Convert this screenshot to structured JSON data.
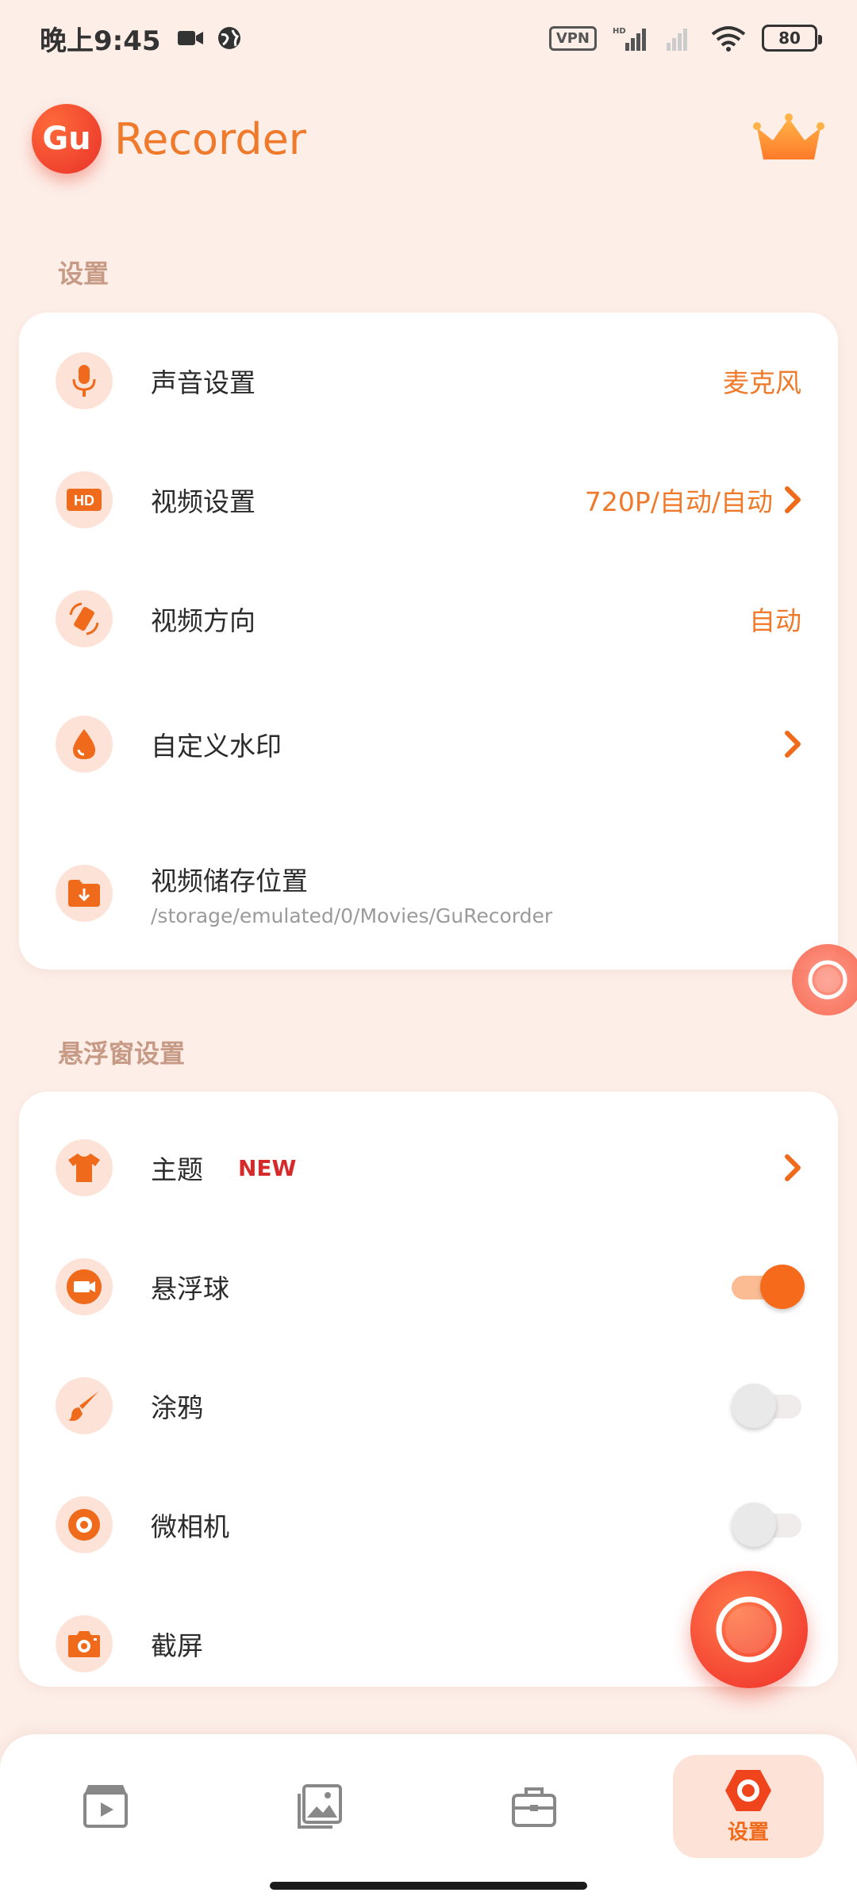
{
  "status_bar": {
    "time": "晚上9:45",
    "vpn": "VPN",
    "network": "HD",
    "battery": "80"
  },
  "header": {
    "logo_text": "Gu",
    "title": "Recorder",
    "premium_icon": "crown-icon"
  },
  "settings_section": {
    "title": "设置",
    "items": [
      {
        "label": "声音设置",
        "value": "麦克风",
        "icon": "microphone-icon"
      },
      {
        "label": "视频设置",
        "value": "720P/自动/自动",
        "icon": "hd-icon"
      },
      {
        "label": "视频方向",
        "value": "自动",
        "icon": "rotate-icon"
      },
      {
        "label": "自定义水印",
        "value": "",
        "icon": "water-drop-icon"
      },
      {
        "label": "视频储存位置",
        "sub": "/storage/emulated/0/Movies/GuRecorder",
        "icon": "folder-download-icon"
      }
    ]
  },
  "floating_section": {
    "title": "悬浮窗设置",
    "items": [
      {
        "label": "主题",
        "badge": "NEW",
        "icon": "tshirt-icon"
      },
      {
        "label": "悬浮球",
        "toggle": true,
        "icon": "video-camera-icon"
      },
      {
        "label": "涂鸦",
        "toggle": false,
        "icon": "brush-icon"
      },
      {
        "label": "微相机",
        "toggle": false,
        "icon": "camera-lens-icon"
      },
      {
        "label": "截屏",
        "icon": "camera-icon"
      }
    ]
  },
  "bottom_nav": {
    "items": [
      {
        "name": "videos",
        "icon": "film-icon"
      },
      {
        "name": "images",
        "icon": "gallery-icon"
      },
      {
        "name": "tools",
        "icon": "toolbox-icon"
      },
      {
        "name": "settings",
        "icon": "settings-hex-icon",
        "label": "设置",
        "active": true
      }
    ]
  },
  "colors": {
    "accent": "#f07a2b",
    "background": "#fdeee8",
    "icon_bg": "#fde3d7"
  }
}
